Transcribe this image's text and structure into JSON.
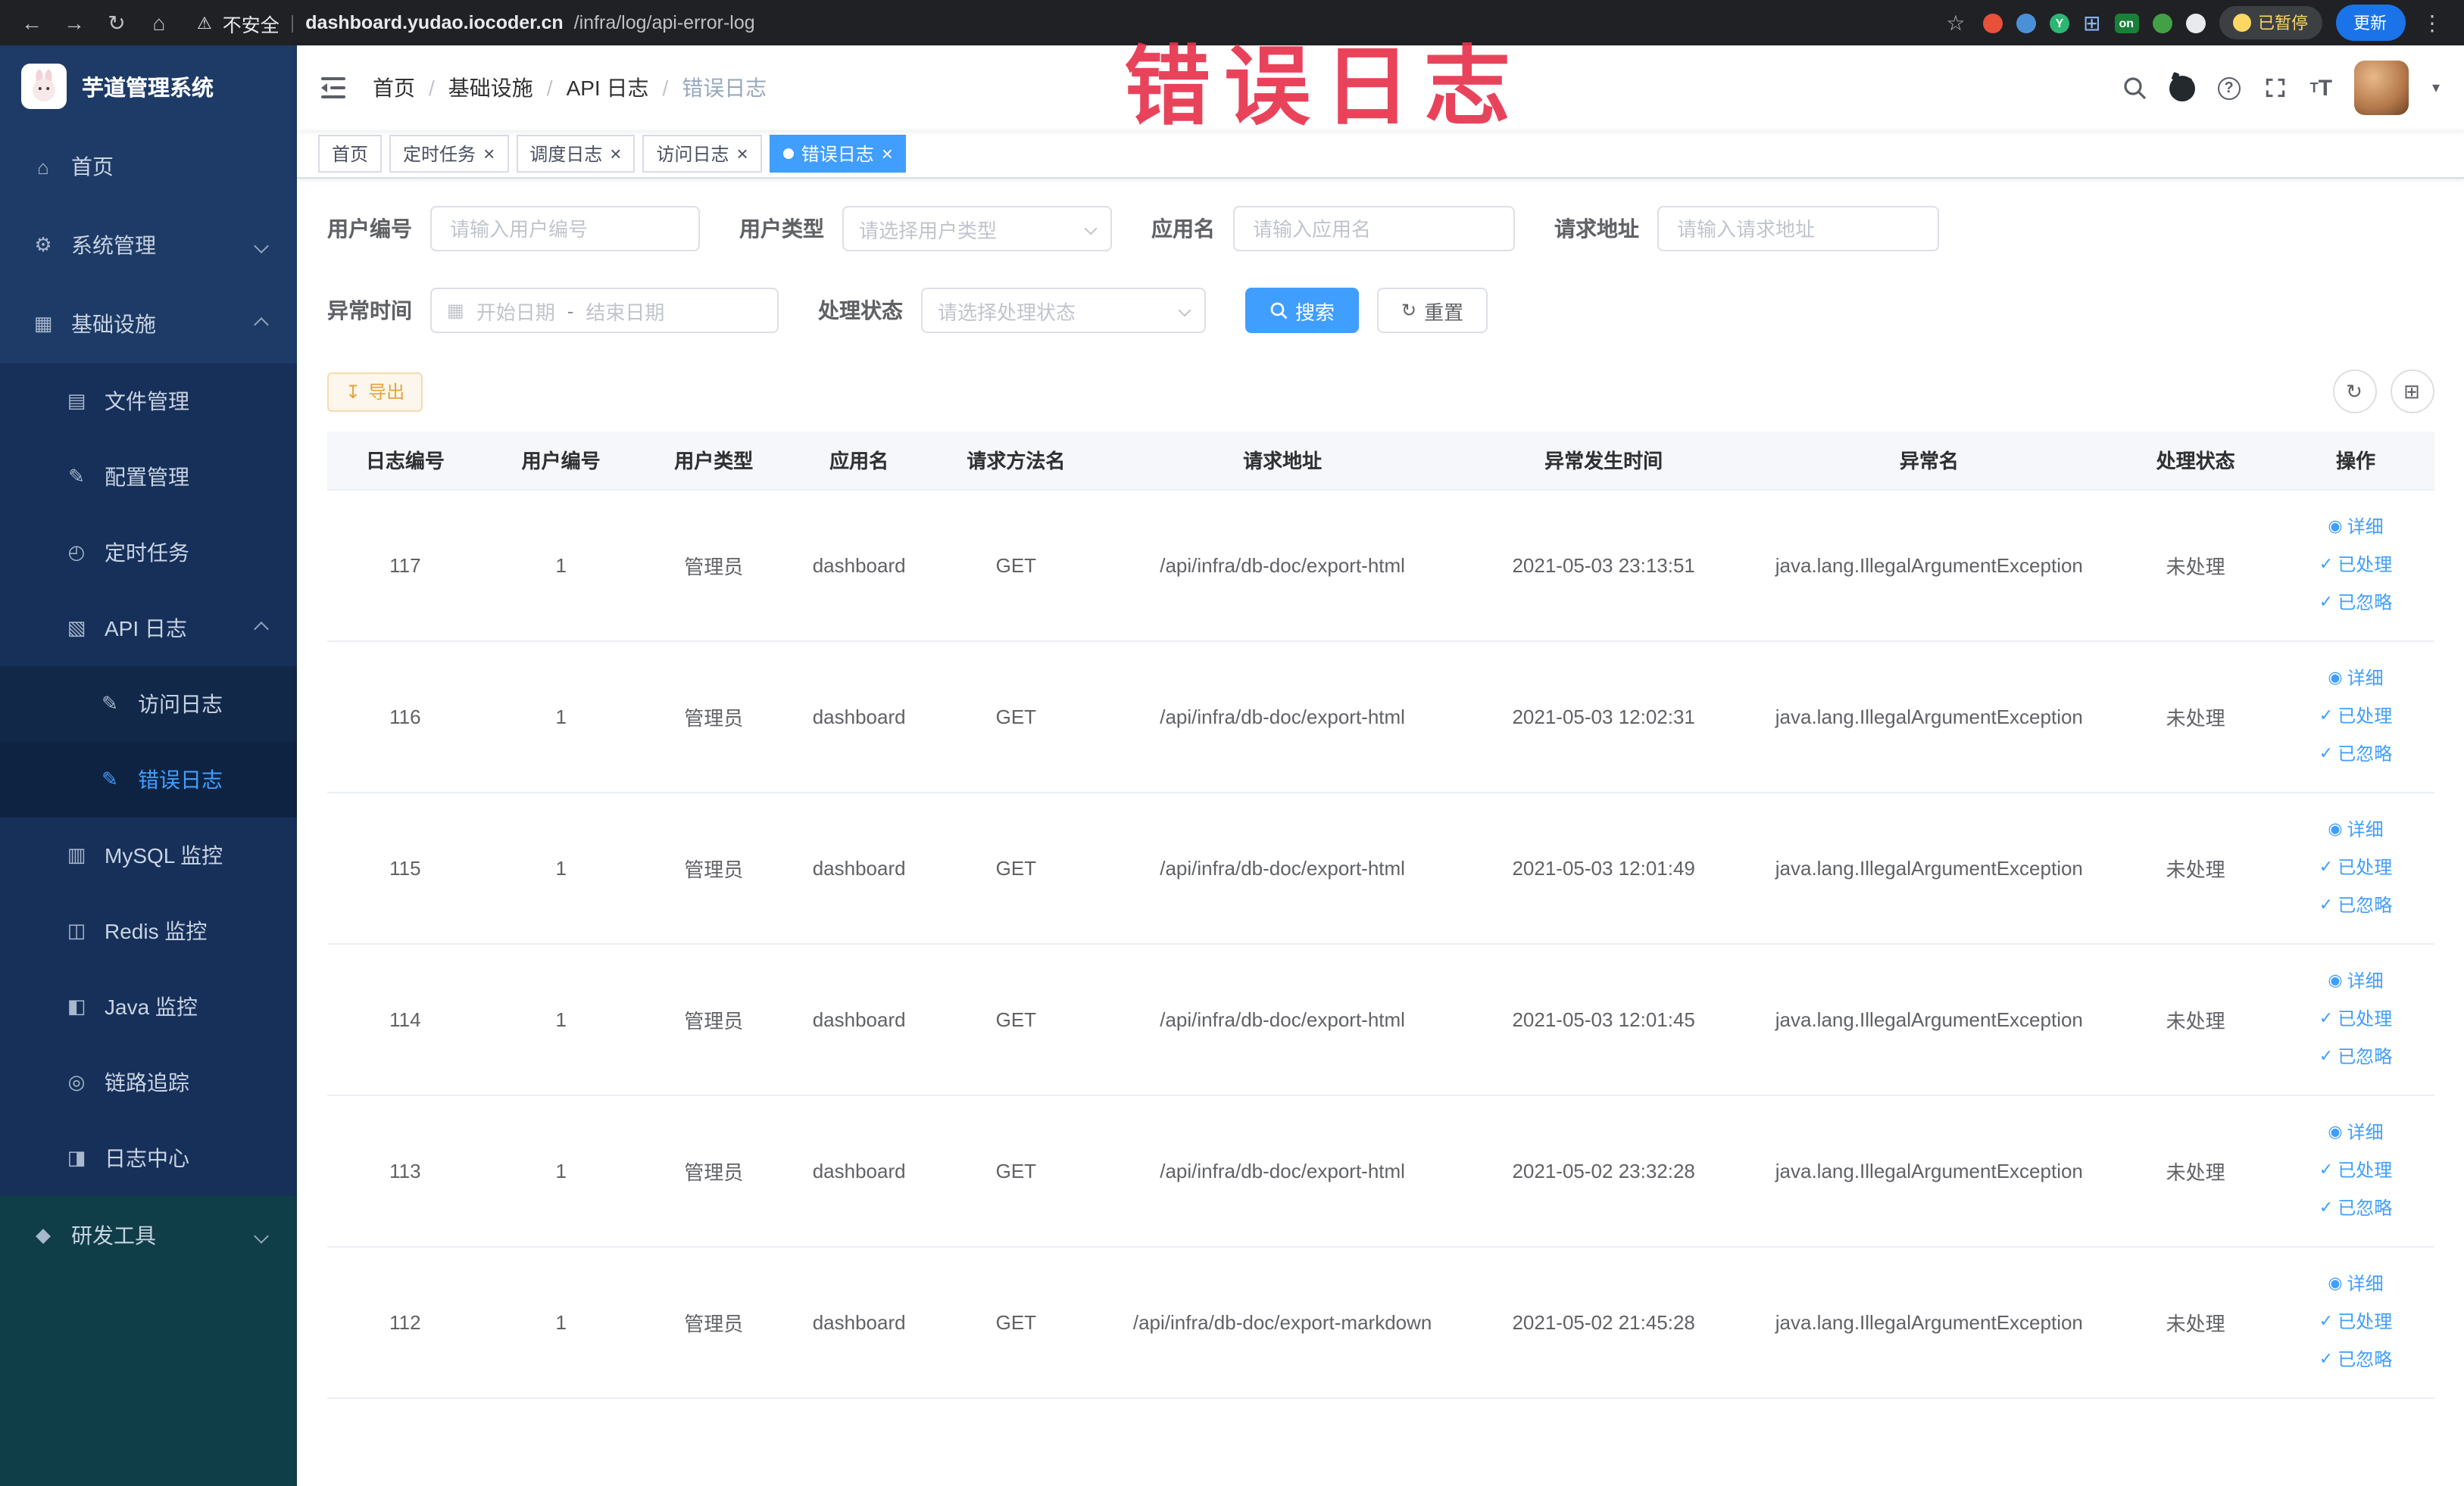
{
  "browser": {
    "security_label": "不安全",
    "url_domain": "dashboard.yudao.iocoder.cn",
    "url_path": "/infra/log/api-error-log",
    "paused_badge": "已暂停",
    "update_button": "更新",
    "extension_on_badge": "on"
  },
  "sidebar": {
    "title": "芋道管理系统",
    "items": [
      {
        "label": "首页"
      },
      {
        "label": "系统管理"
      },
      {
        "label": "基础设施"
      },
      {
        "label": "文件管理"
      },
      {
        "label": "配置管理"
      },
      {
        "label": "定时任务"
      },
      {
        "label": "API 日志"
      },
      {
        "label": "访问日志"
      },
      {
        "label": "错误日志"
      },
      {
        "label": "MySQL 监控"
      },
      {
        "label": "Redis 监控"
      },
      {
        "label": "Java 监控"
      },
      {
        "label": "链路追踪"
      },
      {
        "label": "日志中心"
      },
      {
        "label": "研发工具"
      }
    ]
  },
  "header": {
    "breadcrumb": [
      "首页",
      "基础设施",
      "API 日志",
      "错误日志"
    ],
    "breadcrumb_separator": "/",
    "watermark": "错误日志"
  },
  "tabs": [
    {
      "label": "首页"
    },
    {
      "label": "定时任务"
    },
    {
      "label": "调度日志"
    },
    {
      "label": "访问日志"
    },
    {
      "label": "错误日志"
    }
  ],
  "filters": {
    "user_id": {
      "label": "用户编号",
      "placeholder": "请输入用户编号"
    },
    "user_type": {
      "label": "用户类型",
      "placeholder": "请选择用户类型"
    },
    "app_name": {
      "label": "应用名",
      "placeholder": "请输入应用名"
    },
    "request_url": {
      "label": "请求地址",
      "placeholder": "请输入请求地址"
    },
    "exception_time": {
      "label": "异常时间",
      "start_placeholder": "开始日期",
      "separator": "-",
      "end_placeholder": "结束日期"
    },
    "process_status": {
      "label": "处理状态",
      "placeholder": "请选择处理状态"
    },
    "search_button": "搜索",
    "reset_button": "重置"
  },
  "toolbar": {
    "export_button": "导出"
  },
  "table": {
    "columns": [
      "日志编号",
      "用户编号",
      "用户类型",
      "应用名",
      "请求方法名",
      "请求地址",
      "异常发生时间",
      "异常名",
      "处理状态",
      "操作"
    ],
    "action_labels": {
      "detail": "详细",
      "process": "已处理",
      "ignore": "已忽略"
    },
    "rows": [
      {
        "id": "117",
        "user_id": "1",
        "user_type": "管理员",
        "app": "dashboard",
        "method": "GET",
        "url": "/api/infra/db-doc/export-html",
        "time": "2021-05-03 23:13:51",
        "exception": "java.lang.IllegalArgumentException",
        "status": "未处理"
      },
      {
        "id": "116",
        "user_id": "1",
        "user_type": "管理员",
        "app": "dashboard",
        "method": "GET",
        "url": "/api/infra/db-doc/export-html",
        "time": "2021-05-03 12:02:31",
        "exception": "java.lang.IllegalArgumentException",
        "status": "未处理"
      },
      {
        "id": "115",
        "user_id": "1",
        "user_type": "管理员",
        "app": "dashboard",
        "method": "GET",
        "url": "/api/infra/db-doc/export-html",
        "time": "2021-05-03 12:01:49",
        "exception": "java.lang.IllegalArgumentException",
        "status": "未处理"
      },
      {
        "id": "114",
        "user_id": "1",
        "user_type": "管理员",
        "app": "dashboard",
        "method": "GET",
        "url": "/api/infra/db-doc/export-html",
        "time": "2021-05-03 12:01:45",
        "exception": "java.lang.IllegalArgumentException",
        "status": "未处理"
      },
      {
        "id": "113",
        "user_id": "1",
        "user_type": "管理员",
        "app": "dashboard",
        "method": "GET",
        "url": "/api/infra/db-doc/export-html",
        "time": "2021-05-02 23:32:28",
        "exception": "java.lang.IllegalArgumentException",
        "status": "未处理"
      },
      {
        "id": "112",
        "user_id": "1",
        "user_type": "管理员",
        "app": "dashboard",
        "method": "GET",
        "url": "/api/infra/db-doc/export-markdown",
        "time": "2021-05-02 21:45:28",
        "exception": "java.lang.IllegalArgumentException",
        "status": "未处理"
      }
    ]
  },
  "icons": {
    "back": "←",
    "forward": "→",
    "reload": "↻",
    "home_nav": "⌂",
    "warning": "⚠",
    "star": "☆",
    "kebab": "⋮",
    "home": "⌂",
    "system": "⚙",
    "infra": "▦",
    "file": "▤",
    "config": "✎",
    "timer": "◴",
    "api_log": "▧",
    "access_log": "✎",
    "error_log": "✎",
    "mysql": "▥",
    "redis": "◫",
    "java": "◧",
    "trace": "◎",
    "log_center": "◨",
    "devtools": "◆",
    "calendar": "▦",
    "download": "↧",
    "refresh": "↻",
    "grid": "⊞",
    "eye": "◉",
    "check": "✓",
    "close": "×",
    "caret": "▾",
    "ext_grid": "⊞"
  }
}
